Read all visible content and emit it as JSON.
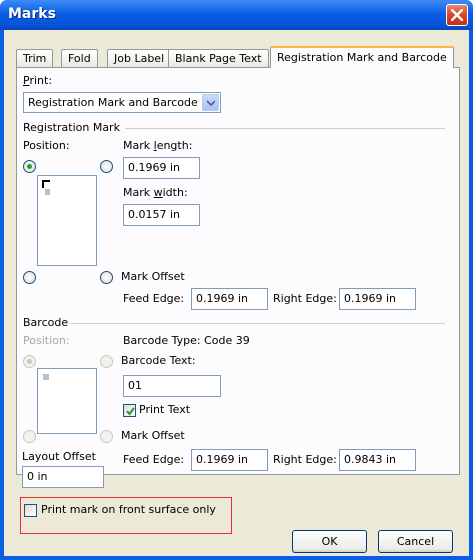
{
  "window": {
    "title": "Marks"
  },
  "tabs": [
    "Trim",
    "Fold",
    "Job Label",
    "Blank Page Text",
    "Registration Mark and Barcode"
  ],
  "print": {
    "label": "Print:",
    "value": "Registration Mark and Barcode"
  },
  "registration": {
    "group_label": "Registration Mark",
    "position_label": "Position:",
    "selected_position": "top-left",
    "mark_length_label": "Mark length:",
    "mark_length": "0.1969 in",
    "mark_width_label": "Mark width:",
    "mark_width": "0.0157 in",
    "mark_offset_label": "Mark Offset",
    "feed_edge_label": "Feed Edge:",
    "feed_edge": "0.1969 in",
    "right_edge_label": "Right Edge:",
    "right_edge": "0.1969 in"
  },
  "barcode": {
    "group_label": "Barcode",
    "position_label": "Position:",
    "type_text": "Barcode Type: Code 39",
    "barcode_text_label": "Barcode Text:",
    "barcode_text": "01",
    "print_text_label": "Print Text",
    "print_text_checked": true,
    "mark_offset_label": "Mark Offset",
    "feed_edge_label": "Feed Edge:",
    "feed_edge": "0.1969 in",
    "right_edge_label": "Right Edge:",
    "right_edge": "0.9843 in"
  },
  "layout_offset": {
    "label": "Layout Offset",
    "value": "0 in"
  },
  "front_surface": {
    "label": "Print mark on front surface only",
    "checked": false
  },
  "buttons": {
    "ok": "OK",
    "cancel": "Cancel"
  },
  "colors": {
    "title_bar": "#0a5ee3",
    "dialog_bg": "#ece9d8",
    "highlight": "#e03030"
  }
}
